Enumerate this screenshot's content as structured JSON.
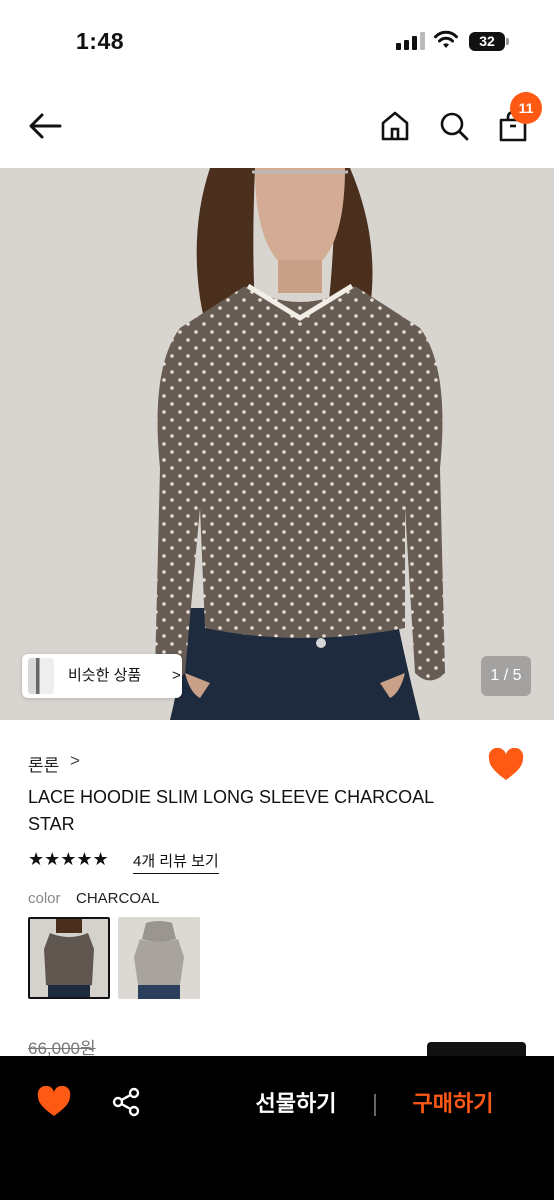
{
  "status_bar": {
    "time": "1:48",
    "battery": "32"
  },
  "nav": {
    "back_icon": "arrow-left-icon",
    "home_icon": "home-icon",
    "search_icon": "search-icon",
    "bag_icon": "shopping-bag-icon",
    "cart_count": "11"
  },
  "gallery": {
    "similar_label": "비슷한 상품",
    "similar_chevron": ">",
    "page_indicator": "1 / 5"
  },
  "product": {
    "brand": "론론",
    "brand_chevron": ">",
    "name": "LACE HOODIE SLIM LONG SLEEVE CHARCOAL STAR",
    "rating": 5,
    "stars": "★★★★★",
    "review_link": "4개 리뷰 보기",
    "color_label": "color",
    "color_value": "CHARCOAL",
    "price": "66,000원"
  },
  "bottom_bar": {
    "gift_label": "선물하기",
    "buy_label": "구매하기"
  },
  "colors": {
    "accent": "#ff5a14",
    "bar_background": "#000000"
  }
}
